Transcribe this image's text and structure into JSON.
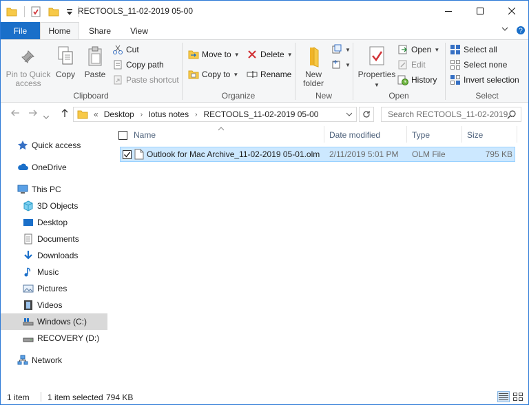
{
  "window": {
    "title": "RECTOOLS_11-02-2019 05-00",
    "controls": {
      "minimize": "—",
      "maximize": "☐",
      "close": "✕"
    }
  },
  "ribbon": {
    "tabs": {
      "file": "File",
      "home": "Home",
      "share": "Share",
      "view": "View"
    },
    "right": {
      "collapse": "⌄",
      "help": "?"
    },
    "clipboard": {
      "label": "Clipboard",
      "pin": "Pin to Quick access",
      "copy": "Copy",
      "paste": "Paste",
      "cut": "Cut",
      "copy_path": "Copy path",
      "paste_shortcut": "Paste shortcut"
    },
    "organize": {
      "label": "Organize",
      "move_to": "Move to",
      "copy_to": "Copy to",
      "delete": "Delete",
      "rename": "Rename"
    },
    "new": {
      "label": "New",
      "new_folder": "New folder"
    },
    "open": {
      "label": "Open",
      "properties": "Properties",
      "open": "Open",
      "edit": "Edit",
      "history": "History"
    },
    "select": {
      "label": "Select",
      "select_all": "Select all",
      "select_none": "Select none",
      "invert": "Invert selection"
    }
  },
  "address": {
    "crumbs": [
      "Desktop",
      "lotus notes",
      "RECTOOLS_11-02-2019 05-00"
    ],
    "overflow": "«",
    "search_placeholder": "Search RECTOOLS_11-02-2019..."
  },
  "navpane": {
    "quick_access": "Quick access",
    "onedrive": "OneDrive",
    "this_pc": "This PC",
    "items": [
      "3D Objects",
      "Desktop",
      "Documents",
      "Downloads",
      "Music",
      "Pictures",
      "Videos",
      "Windows (C:)",
      "RECOVERY (D:)"
    ],
    "network": "Network"
  },
  "columns": {
    "name": "Name",
    "date": "Date modified",
    "type": "Type",
    "size": "Size"
  },
  "files": [
    {
      "name": "Outlook for Mac Archive_11-02-2019 05-01.olm",
      "date": "2/11/2019 5:01 PM",
      "type": "OLM File",
      "size": "795 KB",
      "selected": true
    }
  ],
  "status": {
    "count": "1 item",
    "selection": "1 item selected",
    "size": "794 KB"
  },
  "colors": {
    "accent": "#1a6fc9",
    "selection": "#cce8ff",
    "selection_border": "#99d1ff",
    "folder": "#f7c948"
  }
}
